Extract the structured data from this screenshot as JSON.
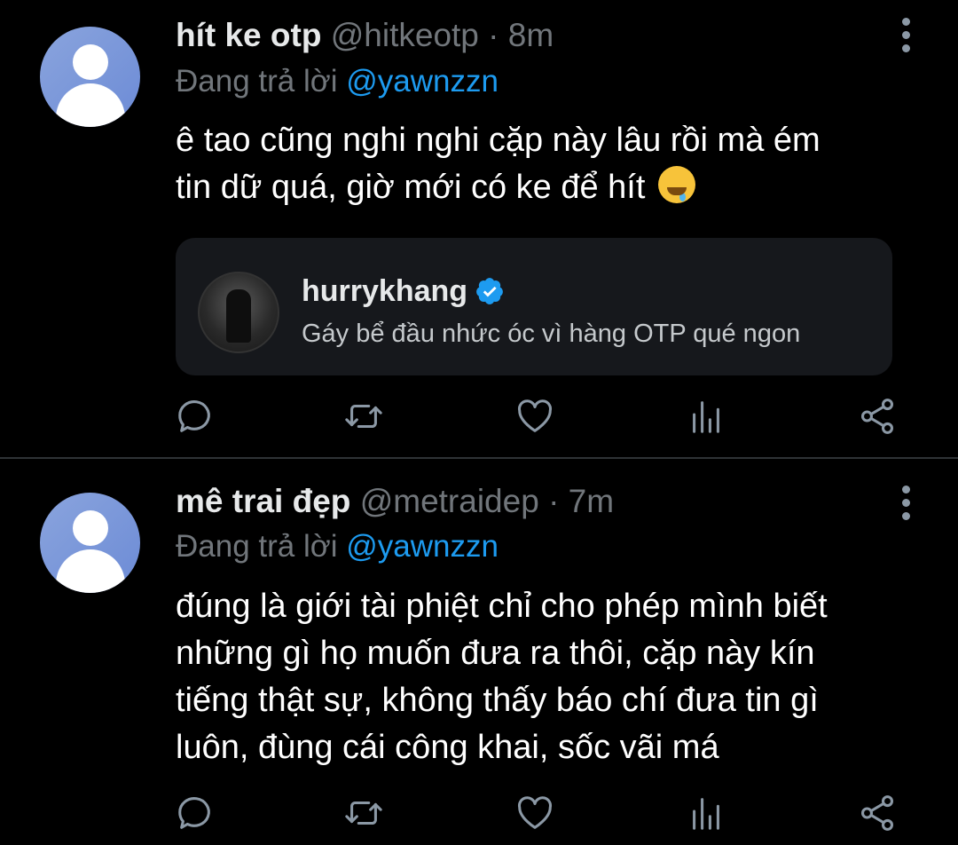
{
  "tweets": [
    {
      "display_name": "hít ke otp",
      "handle": "@hitkeotp",
      "separator": "·",
      "time": "8m",
      "replying_prefix": "Đang trả lời",
      "replying_to": "@yawnzzn",
      "text_lines": [
        "ê tao cũng nghi nghi cặp này lâu rồi mà ém",
        "tin dữ quá, giờ mới có ke để hít"
      ],
      "emoji": "drooling-face",
      "card": {
        "name": "hurrykhang",
        "verified": true,
        "bio": "Gáy bể đầu nhức óc vì hàng OTP qué ngon"
      }
    },
    {
      "display_name": "mê trai đẹp",
      "handle": "@metraidep",
      "separator": "·",
      "time": "7m",
      "replying_prefix": "Đang trả lời",
      "replying_to": "@yawnzzn",
      "text_lines": [
        "đúng là giới tài phiệt chỉ cho phép mình biết",
        "những gì họ muốn đưa ra thôi, cặp này kín",
        "tiếng thật sự, không thấy báo chí đưa tin gì",
        "luôn, đùng cái công khai, sốc vãi má"
      ]
    }
  ],
  "actions": [
    "reply-icon",
    "retweet-icon",
    "like-icon",
    "analytics-icon",
    "share-icon"
  ],
  "colors": {
    "background": "#000000",
    "text": "#e7e9ea",
    "secondary": "#71767b",
    "link": "#1d9bf0",
    "card_bg": "#16181c",
    "icon": "#8b98a5",
    "divider": "#2f3336"
  }
}
